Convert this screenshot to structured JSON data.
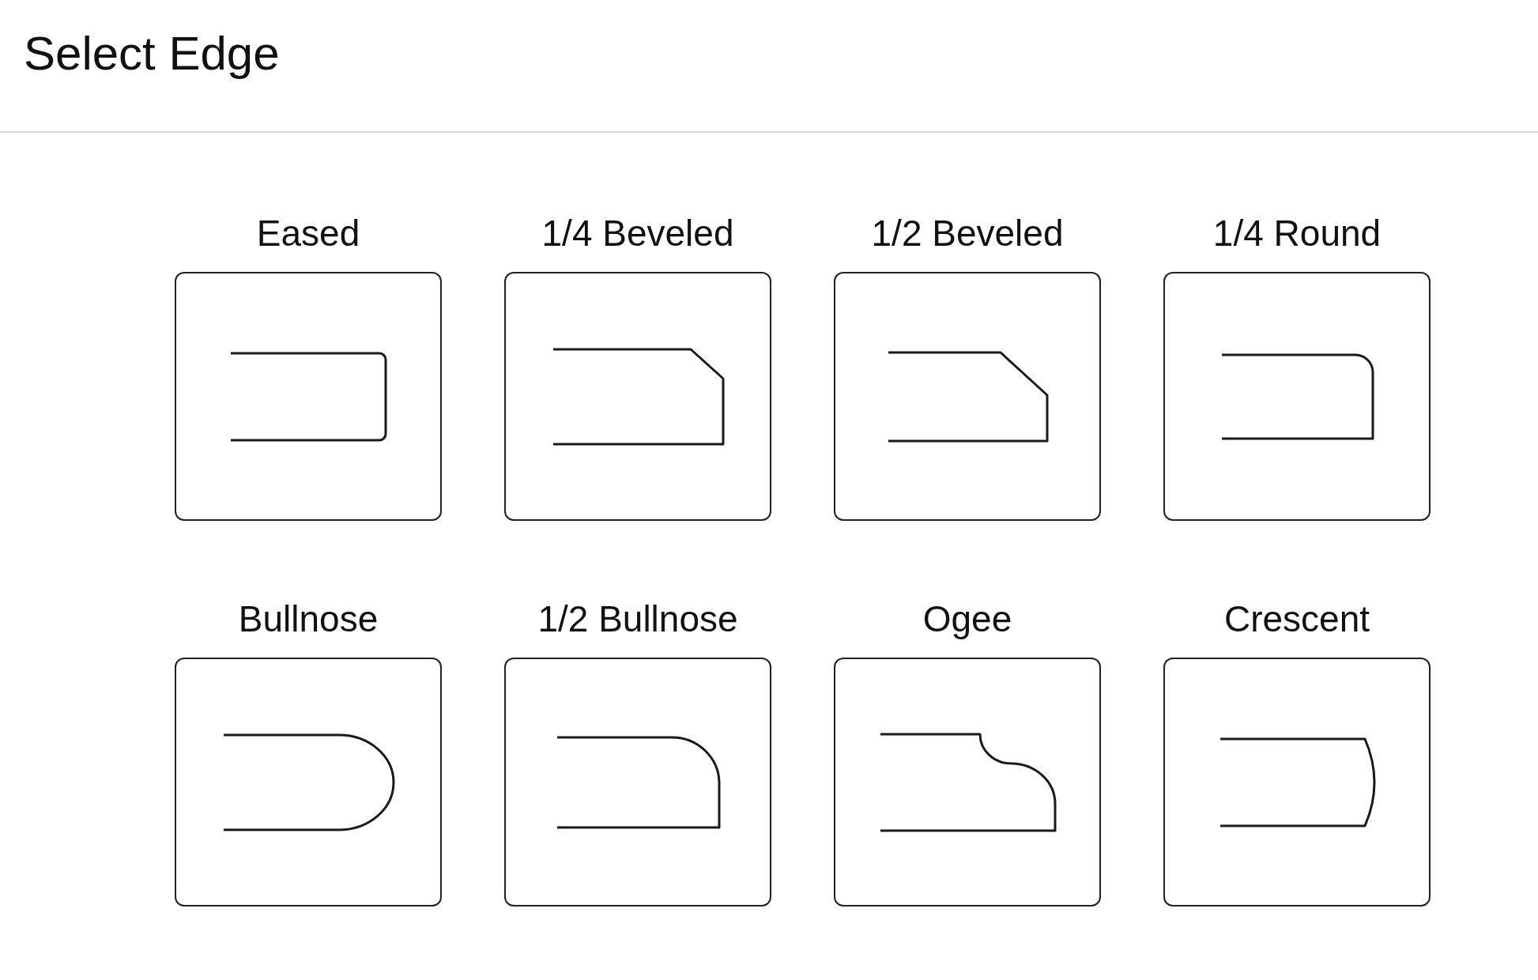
{
  "title": "Select Edge",
  "edges": [
    {
      "label": "Eased",
      "kind": "eased"
    },
    {
      "label": "1/4 Beveled",
      "kind": "quarterbevel"
    },
    {
      "label": "1/2 Beveled",
      "kind": "halfbevel"
    },
    {
      "label": "1/4 Round",
      "kind": "quarterround"
    },
    {
      "label": "Bullnose",
      "kind": "bullnose"
    },
    {
      "label": "1/2 Bullnose",
      "kind": "halfbullnose"
    },
    {
      "label": "Ogee",
      "kind": "ogee"
    },
    {
      "label": "Crescent",
      "kind": "crescent"
    }
  ]
}
